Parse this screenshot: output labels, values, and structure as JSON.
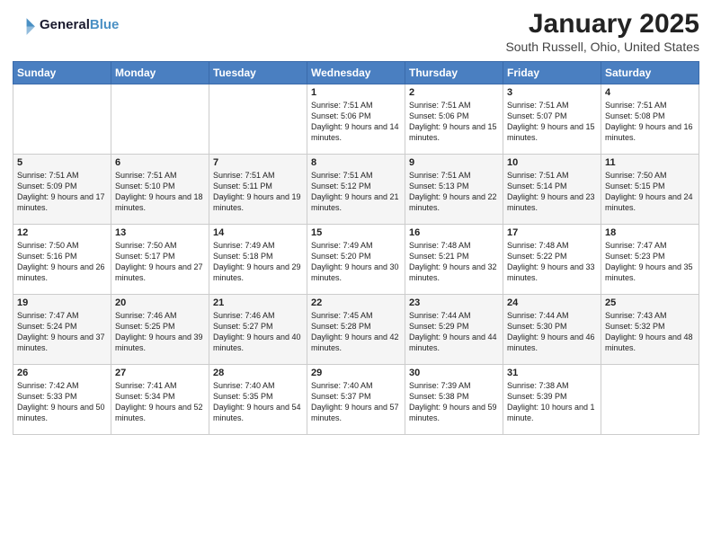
{
  "header": {
    "logo_line1": "General",
    "logo_line2": "Blue",
    "title": "January 2025",
    "subtitle": "South Russell, Ohio, United States"
  },
  "days_of_week": [
    "Sunday",
    "Monday",
    "Tuesday",
    "Wednesday",
    "Thursday",
    "Friday",
    "Saturday"
  ],
  "weeks": [
    [
      {
        "day": "",
        "info": ""
      },
      {
        "day": "",
        "info": ""
      },
      {
        "day": "",
        "info": ""
      },
      {
        "day": "1",
        "info": "Sunrise: 7:51 AM\nSunset: 5:06 PM\nDaylight: 9 hours\nand 14 minutes."
      },
      {
        "day": "2",
        "info": "Sunrise: 7:51 AM\nSunset: 5:06 PM\nDaylight: 9 hours\nand 15 minutes."
      },
      {
        "day": "3",
        "info": "Sunrise: 7:51 AM\nSunset: 5:07 PM\nDaylight: 9 hours\nand 15 minutes."
      },
      {
        "day": "4",
        "info": "Sunrise: 7:51 AM\nSunset: 5:08 PM\nDaylight: 9 hours\nand 16 minutes."
      }
    ],
    [
      {
        "day": "5",
        "info": "Sunrise: 7:51 AM\nSunset: 5:09 PM\nDaylight: 9 hours\nand 17 minutes."
      },
      {
        "day": "6",
        "info": "Sunrise: 7:51 AM\nSunset: 5:10 PM\nDaylight: 9 hours\nand 18 minutes."
      },
      {
        "day": "7",
        "info": "Sunrise: 7:51 AM\nSunset: 5:11 PM\nDaylight: 9 hours\nand 19 minutes."
      },
      {
        "day": "8",
        "info": "Sunrise: 7:51 AM\nSunset: 5:12 PM\nDaylight: 9 hours\nand 21 minutes."
      },
      {
        "day": "9",
        "info": "Sunrise: 7:51 AM\nSunset: 5:13 PM\nDaylight: 9 hours\nand 22 minutes."
      },
      {
        "day": "10",
        "info": "Sunrise: 7:51 AM\nSunset: 5:14 PM\nDaylight: 9 hours\nand 23 minutes."
      },
      {
        "day": "11",
        "info": "Sunrise: 7:50 AM\nSunset: 5:15 PM\nDaylight: 9 hours\nand 24 minutes."
      }
    ],
    [
      {
        "day": "12",
        "info": "Sunrise: 7:50 AM\nSunset: 5:16 PM\nDaylight: 9 hours\nand 26 minutes."
      },
      {
        "day": "13",
        "info": "Sunrise: 7:50 AM\nSunset: 5:17 PM\nDaylight: 9 hours\nand 27 minutes."
      },
      {
        "day": "14",
        "info": "Sunrise: 7:49 AM\nSunset: 5:18 PM\nDaylight: 9 hours\nand 29 minutes."
      },
      {
        "day": "15",
        "info": "Sunrise: 7:49 AM\nSunset: 5:20 PM\nDaylight: 9 hours\nand 30 minutes."
      },
      {
        "day": "16",
        "info": "Sunrise: 7:48 AM\nSunset: 5:21 PM\nDaylight: 9 hours\nand 32 minutes."
      },
      {
        "day": "17",
        "info": "Sunrise: 7:48 AM\nSunset: 5:22 PM\nDaylight: 9 hours\nand 33 minutes."
      },
      {
        "day": "18",
        "info": "Sunrise: 7:47 AM\nSunset: 5:23 PM\nDaylight: 9 hours\nand 35 minutes."
      }
    ],
    [
      {
        "day": "19",
        "info": "Sunrise: 7:47 AM\nSunset: 5:24 PM\nDaylight: 9 hours\nand 37 minutes."
      },
      {
        "day": "20",
        "info": "Sunrise: 7:46 AM\nSunset: 5:25 PM\nDaylight: 9 hours\nand 39 minutes."
      },
      {
        "day": "21",
        "info": "Sunrise: 7:46 AM\nSunset: 5:27 PM\nDaylight: 9 hours\nand 40 minutes."
      },
      {
        "day": "22",
        "info": "Sunrise: 7:45 AM\nSunset: 5:28 PM\nDaylight: 9 hours\nand 42 minutes."
      },
      {
        "day": "23",
        "info": "Sunrise: 7:44 AM\nSunset: 5:29 PM\nDaylight: 9 hours\nand 44 minutes."
      },
      {
        "day": "24",
        "info": "Sunrise: 7:44 AM\nSunset: 5:30 PM\nDaylight: 9 hours\nand 46 minutes."
      },
      {
        "day": "25",
        "info": "Sunrise: 7:43 AM\nSunset: 5:32 PM\nDaylight: 9 hours\nand 48 minutes."
      }
    ],
    [
      {
        "day": "26",
        "info": "Sunrise: 7:42 AM\nSunset: 5:33 PM\nDaylight: 9 hours\nand 50 minutes."
      },
      {
        "day": "27",
        "info": "Sunrise: 7:41 AM\nSunset: 5:34 PM\nDaylight: 9 hours\nand 52 minutes."
      },
      {
        "day": "28",
        "info": "Sunrise: 7:40 AM\nSunset: 5:35 PM\nDaylight: 9 hours\nand 54 minutes."
      },
      {
        "day": "29",
        "info": "Sunrise: 7:40 AM\nSunset: 5:37 PM\nDaylight: 9 hours\nand 57 minutes."
      },
      {
        "day": "30",
        "info": "Sunrise: 7:39 AM\nSunset: 5:38 PM\nDaylight: 9 hours\nand 59 minutes."
      },
      {
        "day": "31",
        "info": "Sunrise: 7:38 AM\nSunset: 5:39 PM\nDaylight: 10 hours\nand 1 minute."
      },
      {
        "day": "",
        "info": ""
      }
    ]
  ]
}
